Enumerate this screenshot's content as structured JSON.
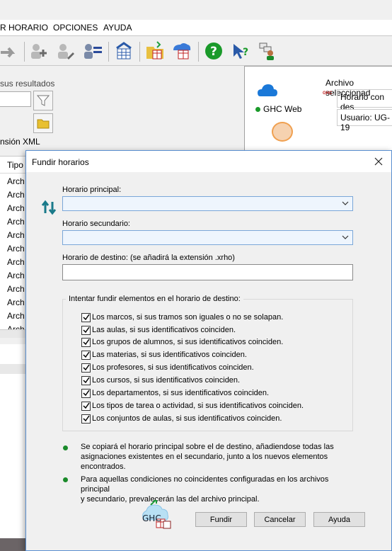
{
  "menu": {
    "items": [
      "R HORARIO",
      "OPCIONES",
      "AYUDA"
    ]
  },
  "left_panel": {
    "results_label": "sus resultados",
    "xml_label": "nsión XML"
  },
  "right_panel": {
    "file_label": "Archivo seleccionad",
    "file_name": "Horario con des",
    "user": "Usuario: UG-19",
    "web_label": "GHC Web",
    "ghc_badge": "GHC",
    "status_color": "#1a9a2a"
  },
  "list": {
    "header": "Tipo",
    "rows": [
      "Arch",
      "Arch",
      "Arch",
      "Arch",
      "Arch",
      "Arch",
      "Arch",
      "Arch",
      "Arch",
      "Arch",
      "Arch",
      "Arch"
    ]
  },
  "dialog": {
    "title": "Fundir horarios",
    "main_label": "Horario principal:",
    "main_value": "",
    "secondary_label": "Horario secundario:",
    "secondary_value": "",
    "dest_label": "Horario de destino: (se añadirá la extensión .xrho)",
    "dest_value": "",
    "group_title": "Intentar fundir elementos en el horario de destino:",
    "checks": [
      {
        "label": "Los marcos, si sus tramos son iguales o no se solapan.",
        "checked": true
      },
      {
        "label": "Las aulas, si sus identificativos coinciden.",
        "checked": true
      },
      {
        "label": "Los grupos de alumnos, si sus identificativos coinciden.",
        "checked": true
      },
      {
        "label": "Las materias, si sus identificativos coinciden.",
        "checked": true
      },
      {
        "label": "Los profesores, si sus identificativos coinciden.",
        "checked": true
      },
      {
        "label": "Los cursos, si sus identificativos coinciden.",
        "checked": true
      },
      {
        "label": "Los departamentos, si sus identificativos coinciden.",
        "checked": true
      },
      {
        "label": "Los tipos de tarea o actividad, si sus identificativos coinciden.",
        "checked": true
      },
      {
        "label": "Los conjuntos de aulas, si sus identificativos coinciden.",
        "checked": true
      }
    ],
    "note1_line1": "Se copiará el horario principal sobre el de destino, añadiendose todas las",
    "note1_line2": "asignaciones existentes en el secundario, junto a los nuevos elementos",
    "note1_line3": "encontrados.",
    "note2_line1": "Para aquellas condiciones no coincidentes configuradas en los archivos principal",
    "note2_line2": "y secundario, prevalecerán las del archivo principal.",
    "logo_text": "GHC",
    "buttons": {
      "merge": "Fundir",
      "cancel": "Cancelar",
      "help": "Ayuda"
    }
  },
  "colors": {
    "accent": "#1a8a2a",
    "dialog_border": "#5a8fd0",
    "combo_bg": "#eef5fd"
  }
}
